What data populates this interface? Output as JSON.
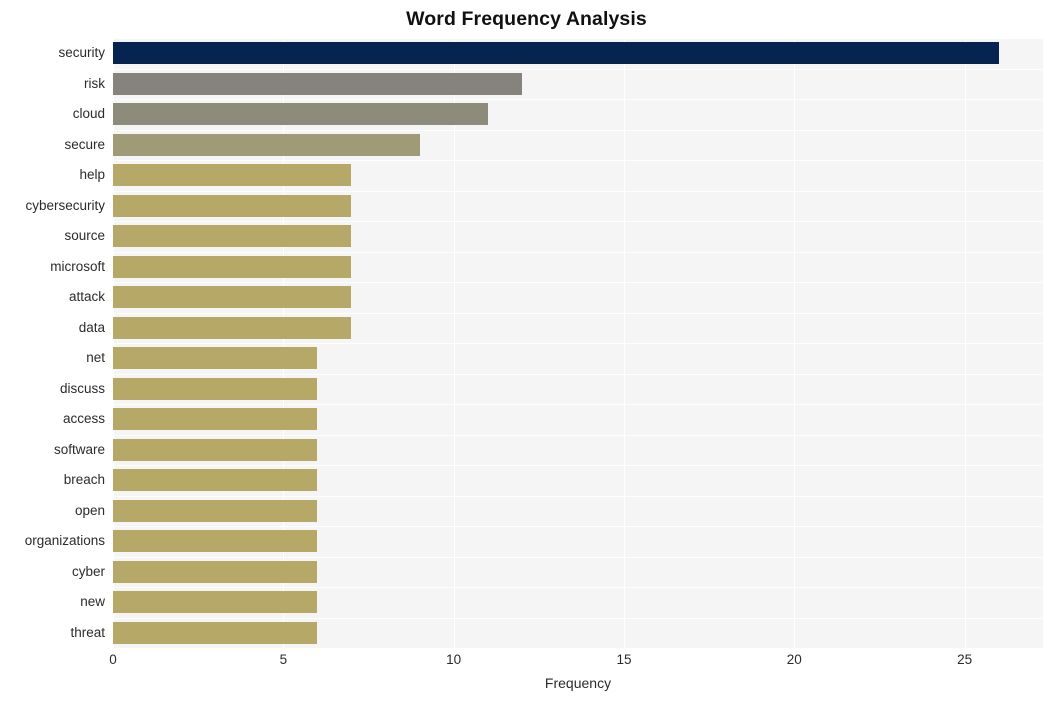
{
  "chart_data": {
    "type": "bar",
    "orientation": "horizontal",
    "title": "Word Frequency Analysis",
    "xlabel": "Frequency",
    "ylabel": "",
    "xlim": [
      0,
      27.3
    ],
    "xticks": [
      0,
      5,
      10,
      15,
      20,
      25
    ],
    "xticklabels": [
      "0",
      "5",
      "10",
      "15",
      "20",
      "25"
    ],
    "grid": true,
    "legend": "none",
    "categories": [
      "security",
      "risk",
      "cloud",
      "secure",
      "help",
      "cybersecurity",
      "source",
      "microsoft",
      "attack",
      "data",
      "net",
      "discuss",
      "access",
      "software",
      "breach",
      "open",
      "organizations",
      "cyber",
      "new",
      "threat"
    ],
    "values": [
      26,
      12,
      11,
      9,
      7,
      7,
      7,
      7,
      7,
      7,
      6,
      6,
      6,
      6,
      6,
      6,
      6,
      6,
      6,
      6
    ],
    "bar_colors": [
      "#052450",
      "#85837c",
      "#8d8b7a",
      "#a09b77",
      "#b6a968",
      "#b6a968",
      "#b6a968",
      "#b6a968",
      "#b6a968",
      "#b6a968",
      "#b6a968",
      "#b6a968",
      "#b6a968",
      "#b6a968",
      "#b6a968",
      "#b6a968",
      "#b6a968",
      "#b6a968",
      "#b6a968",
      "#b6a968"
    ],
    "plot_background": "#f5f5f6",
    "gridline_color": "#ffffff",
    "figure_background": "#ffffff"
  }
}
